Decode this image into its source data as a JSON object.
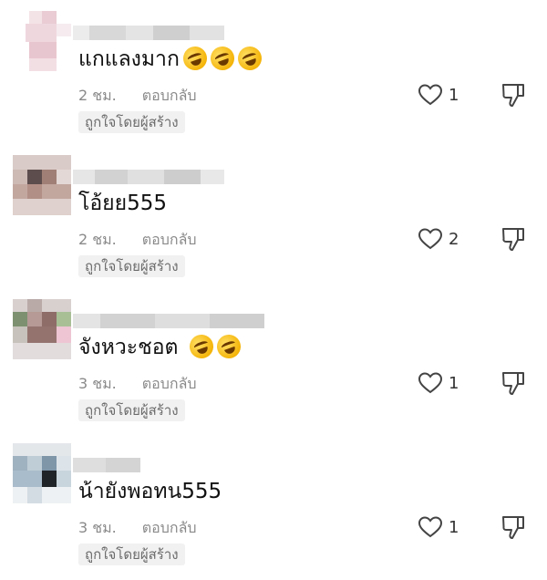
{
  "comments": [
    {
      "text": "แกแลงมาก",
      "emoji_count": 3,
      "time": "2 ชม.",
      "reply_label": "ตอบกลับ",
      "badge": "ถูกใจโดยผู้สร้าง",
      "likes": "1",
      "emoji_icon": "rolling-on-floor-laughing-emoji"
    },
    {
      "text": "โอ้ยย555",
      "emoji_count": 0,
      "time": "2 ชม.",
      "reply_label": "ตอบกลับ",
      "badge": "ถูกใจโดยผู้สร้าง",
      "likes": "2"
    },
    {
      "text": "จังหวะชอต",
      "emoji_count": 2,
      "time": "3 ชม.",
      "reply_label": "ตอบกลับ",
      "badge": "ถูกใจโดยผู้สร้าง",
      "likes": "1",
      "emoji_icon": "rolling-on-floor-laughing-emoji"
    },
    {
      "text": "น้ายังพอทน555",
      "emoji_count": 0,
      "time": "3 ชม.",
      "reply_label": "ตอบกลับ",
      "badge": "ถูกใจโดยผู้สร้าง",
      "likes": "1"
    }
  ],
  "icons": {
    "like": "heart-outline-icon",
    "dislike": "thumbs-down-icon"
  },
  "colors": {
    "meta": "#8a8a8a",
    "badge_bg": "#f1f1f1"
  }
}
